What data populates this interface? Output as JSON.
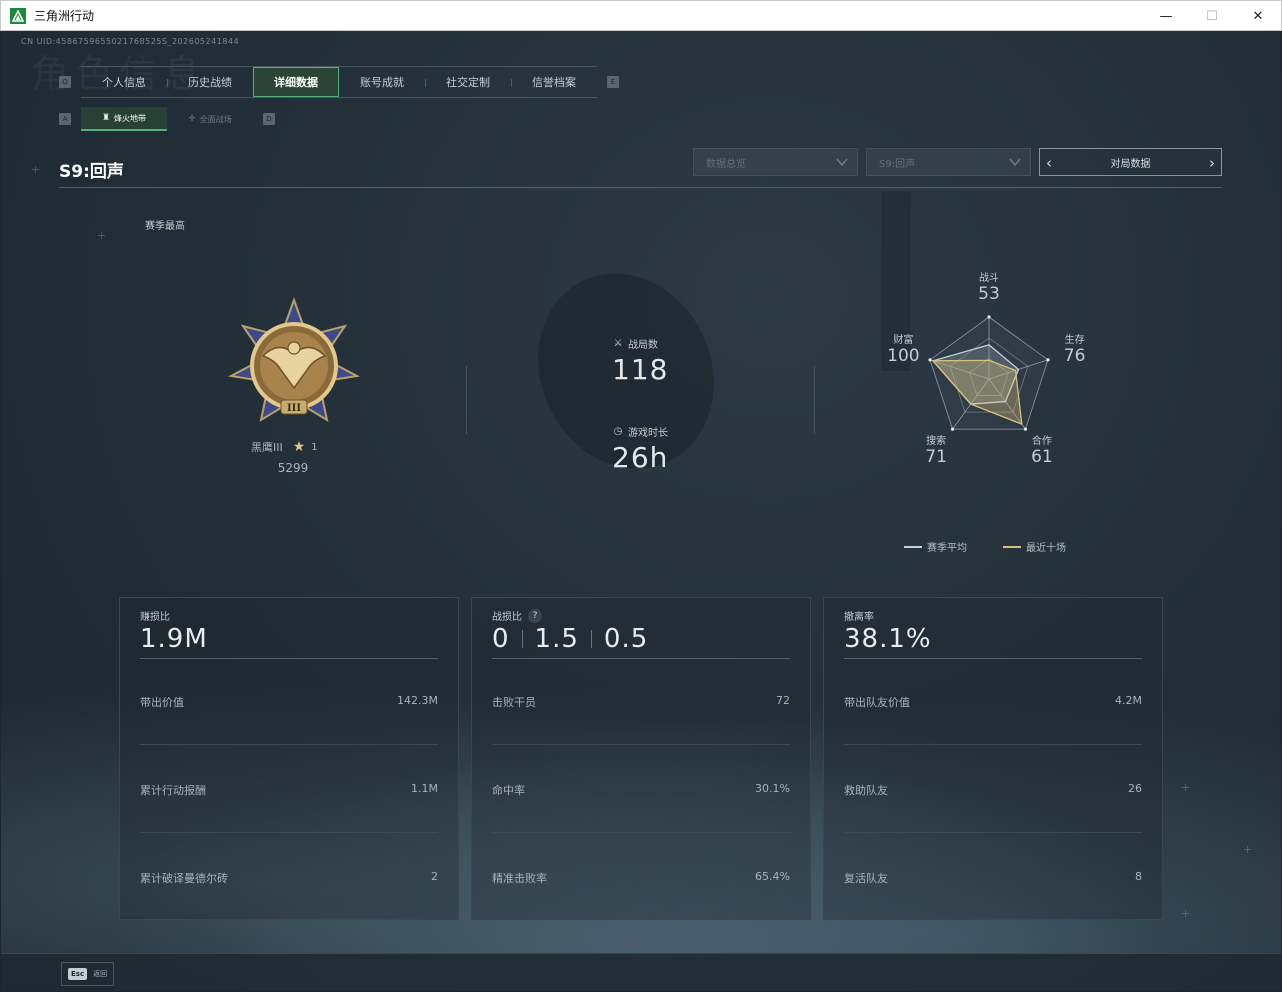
{
  "window": {
    "title": "三角洲行动",
    "minimize": "—",
    "maximize": "☐",
    "close": "✕"
  },
  "header": {
    "uid": "CN UID:4586759655021768525S_202605241844",
    "bg_title": "角色信息",
    "tab_key_left": "Q",
    "tab_key_right": "E",
    "tabs": [
      {
        "label": "个人信息",
        "active": false
      },
      {
        "label": "历史战绩",
        "active": false
      },
      {
        "label": "详细数据",
        "active": true
      },
      {
        "label": "账号成就",
        "active": false
      },
      {
        "label": "社交定制",
        "active": false
      },
      {
        "label": "信誉档案",
        "active": false
      }
    ],
    "subtab_key_left": "A",
    "subtab_key_right": "D",
    "subtabs": [
      {
        "label": "烽火地带",
        "icon": "lighthouse-icon",
        "active": true
      },
      {
        "label": "全面战场",
        "icon": "crosshair-icon",
        "active": false
      }
    ]
  },
  "season": {
    "title": "S9:回声",
    "dropdown_overview": "数据总览",
    "dropdown_season": "S9:回声",
    "match_data_label": "对局数据"
  },
  "rank": {
    "section_label": "赛季最高",
    "name": "黑鹰III",
    "stars": "1",
    "score": "5299"
  },
  "stats": {
    "matches_label": "战局数",
    "matches_value": "118",
    "playtime_label": "游戏时长",
    "playtime_value": "26h"
  },
  "radar": {
    "axes": [
      {
        "label": "战斗",
        "value": "53"
      },
      {
        "label": "生存",
        "value": "76"
      },
      {
        "label": "合作",
        "value": "61"
      },
      {
        "label": "搜索",
        "value": "71"
      },
      {
        "label": "财富",
        "value": "100"
      }
    ],
    "season_avg": [
      0.55,
      0.5,
      0.45,
      0.5,
      0.95
    ],
    "recent_ten": [
      0.3,
      0.45,
      0.9,
      0.5,
      0.95
    ],
    "legend_avg": "赛季平均",
    "legend_recent": "最近十场",
    "color_avg": "#c9d1d8",
    "color_recent": "#d7c07a"
  },
  "cards": [
    {
      "head_label": "赚损比",
      "head_value": "1.9M",
      "rows": [
        {
          "label": "带出价值",
          "value": "142.3M"
        },
        {
          "label": "累计行动报酬",
          "value": "1.1M"
        },
        {
          "label": "累计破译曼德尔砖",
          "value": "2"
        }
      ]
    },
    {
      "head_label": "战损比",
      "head_kd": [
        "0",
        "1.5",
        "0.5"
      ],
      "help": "?",
      "rows": [
        {
          "label": "击败干员",
          "value": "72"
        },
        {
          "label": "命中率",
          "value": "30.1%"
        },
        {
          "label": "精准击败率",
          "value": "65.4%"
        }
      ]
    },
    {
      "head_label": "撤离率",
      "head_value": "38.1%",
      "rows": [
        {
          "label": "带出队友价值",
          "value": "4.2M"
        },
        {
          "label": "救助队友",
          "value": "26"
        },
        {
          "label": "复活队友",
          "value": "8"
        }
      ]
    }
  ],
  "footer": {
    "esc_key": "Esc",
    "esc_label": "返回"
  },
  "colors": {
    "accent": "#52b07a",
    "background": "#1c2630"
  }
}
